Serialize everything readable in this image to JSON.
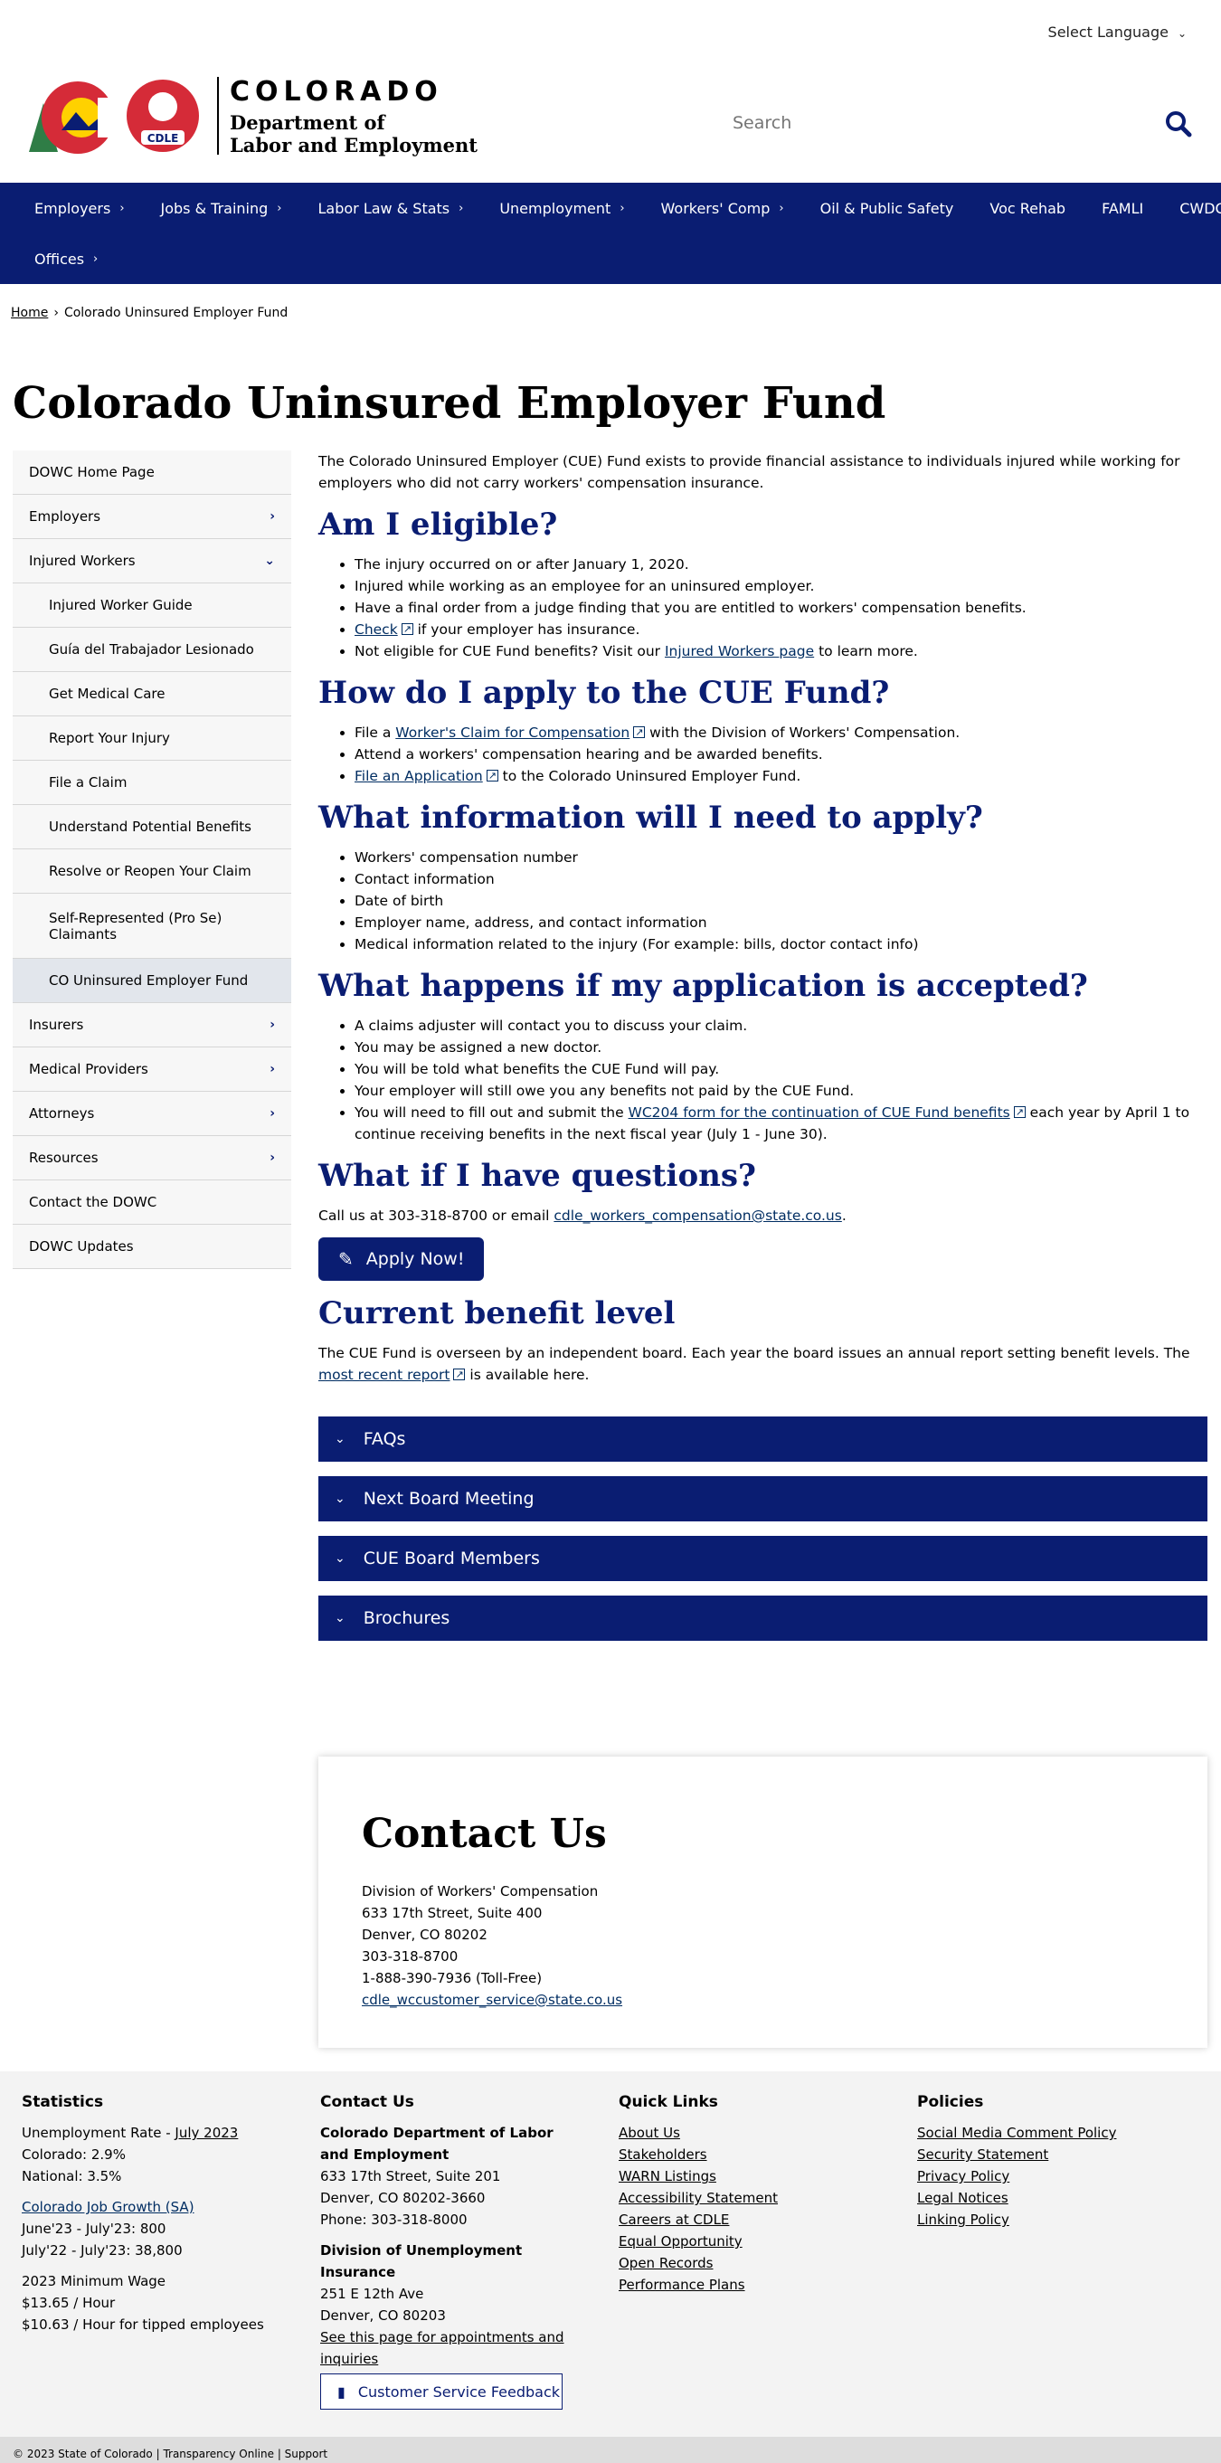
{
  "topbar": {
    "language": "Select Language"
  },
  "logo": {
    "state": "COLORADO",
    "dept_line1": "Department of",
    "dept_line2": "Labor and Employment",
    "badge": "CDLE"
  },
  "search": {
    "placeholder": "Search"
  },
  "nav": {
    "row1": [
      {
        "label": "Employers",
        "caret": true
      },
      {
        "label": "Jobs & Training",
        "caret": true
      },
      {
        "label": "Labor Law & Stats",
        "caret": true
      },
      {
        "label": "Unemployment",
        "caret": true
      },
      {
        "label": "Workers' Comp",
        "caret": true
      },
      {
        "label": "Oil & Public Safety",
        "caret": false
      },
      {
        "label": "Voc Rehab",
        "caret": false
      },
      {
        "label": "FAMLI",
        "caret": false
      },
      {
        "label": "CWDC",
        "caret": false
      }
    ],
    "row2": [
      {
        "label": "Offices",
        "caret": true
      }
    ]
  },
  "breadcrumb": {
    "home": "Home",
    "sep": "›",
    "current": "Colorado Uninsured Employer Fund"
  },
  "page_title": "Colorado Uninsured Employer Fund",
  "sidebar": [
    {
      "label": "DOWC Home Page",
      "level": 0,
      "caret": ""
    },
    {
      "label": "Employers",
      "level": 0,
      "caret": "›"
    },
    {
      "label": "Injured Workers",
      "level": 0,
      "caret": "⌄"
    },
    {
      "label": "Injured Worker Guide",
      "level": 1,
      "caret": ""
    },
    {
      "label": "Guía del Trabajador Lesionado",
      "level": 1,
      "caret": ""
    },
    {
      "label": "Get Medical Care",
      "level": 1,
      "caret": ""
    },
    {
      "label": "Report Your Injury",
      "level": 1,
      "caret": ""
    },
    {
      "label": "File a Claim",
      "level": 1,
      "caret": ""
    },
    {
      "label": "Understand Potential Benefits",
      "level": 1,
      "caret": ""
    },
    {
      "label": "Resolve or Reopen Your Claim",
      "level": 1,
      "caret": ""
    },
    {
      "label": "Self-Represented (Pro Se) Claimants",
      "level": 1,
      "caret": "",
      "tall": true
    },
    {
      "label": "CO Uninsured Employer Fund",
      "level": 1,
      "caret": "",
      "active": true
    },
    {
      "label": "Insurers",
      "level": 0,
      "caret": "›"
    },
    {
      "label": "Medical Providers",
      "level": 0,
      "caret": "›"
    },
    {
      "label": "Attorneys",
      "level": 0,
      "caret": "›"
    },
    {
      "label": "Resources",
      "level": 0,
      "caret": "›"
    },
    {
      "label": "Contact the DOWC",
      "level": 0,
      "caret": ""
    },
    {
      "label": "DOWC Updates",
      "level": 0,
      "caret": ""
    }
  ],
  "content": {
    "intro": "The Colorado Uninsured Employer (CUE) Fund exists to provide financial assistance to individuals injured while working for employers who did not carry workers' compensation insurance.",
    "eligible": {
      "heading": "Am I eligible?",
      "items": [
        "The injury occurred on or after January 1, 2020.",
        "Injured while working as an employee for an uninsured employer.",
        "Have a final order from a judge finding that you are entitled to workers' compensation benefits."
      ],
      "check_link": "Check",
      "check_rest": " if your employer has insurance.",
      "not_eligible_pre": "Not eligible for CUE Fund benefits? Visit our ",
      "not_eligible_link": "Injured Workers page",
      "not_eligible_post": " to learn more."
    },
    "apply": {
      "heading": "How do I apply to the CUE Fund?",
      "item1_pre": "File a ",
      "item1_link": "Worker's Claim for Compensation",
      "item1_post": " with the Division of Workers' Compensation.",
      "item2": "Attend a workers' compensation hearing and be awarded benefits.",
      "item3_link": "File an Application",
      "item3_post": " to the Colorado Uninsured Employer Fund."
    },
    "info": {
      "heading": "What information will I need to apply?",
      "items": [
        "Workers' compensation number",
        "Contact information",
        "Date of birth",
        "Employer name, address, and contact information",
        "Medical information related to the injury (For example: bills, doctor contact info)"
      ]
    },
    "accepted": {
      "heading": "What happens if my application is accepted?",
      "items": [
        "A claims adjuster will contact you to discuss your claim.",
        "You may be assigned a new doctor.",
        "You will be told what benefits the CUE Fund will pay.",
        "Your employer will still owe you any benefits not paid by the CUE Fund."
      ],
      "last_pre": "You will need to fill out and submit the ",
      "last_link": "WC204 form for the continuation of CUE Fund benefits",
      "last_post": " each year by April 1 to continue receiving benefits in the next fiscal year (July 1 - June 30)."
    },
    "questions": {
      "heading": "What if I have questions?",
      "text_pre": "Call us at 303-318-8700 or email ",
      "email": "cdle_workers_compensation@state.co.us",
      "text_post": "."
    },
    "apply_button": "Apply Now!",
    "benefit": {
      "heading": "Current benefit level",
      "text_pre": "The CUE Fund is overseen by an independent board. Each year the board issues an annual report setting benefit levels. The ",
      "link": "most recent report",
      "text_post": " is available here."
    },
    "accordions": [
      "FAQs",
      "Next Board Meeting",
      "CUE Board Members",
      "Brochures"
    ]
  },
  "contact_card": {
    "heading": "Contact Us",
    "lines": [
      "Division of Workers' Compensation",
      "633 17th Street, Suite 400",
      "Denver, CO 80202",
      "303-318-8700",
      "1-888-390-7936 (Toll-Free)"
    ],
    "email": "cdle_wccustomer_service@state.co.us"
  },
  "footer": {
    "statistics": {
      "heading": "Statistics",
      "unemp_pre": "Unemployment Rate - ",
      "unemp_link": "July 2023",
      "colorado": "Colorado: 2.9%",
      "national": "National: 3.5%",
      "jobgrowth_link": "Colorado Job Growth (SA)",
      "jg1": "June'23 - July'23: 800",
      "jg2": "July'22 - July'23: 38,800",
      "minwage_title": "2023 Minimum Wage",
      "mw1": "$13.65 / Hour",
      "mw2": "$10.63 / Hour for tipped employees"
    },
    "contact": {
      "heading": "Contact Us",
      "org1": "Colorado Department of Labor and Employment",
      "addr1": "633 17th Street, Suite 201",
      "city1": "Denver, CO  80202-3660",
      "phone1": "Phone: 303-318-8000",
      "org2": "Division of Unemployment Insurance",
      "addr2": "251 E 12th Ave",
      "city2": "Denver, CO  80203",
      "appt_link": "See this page for appointments and inquiries"
    },
    "quick_links": {
      "heading": "Quick Links",
      "links": [
        "About Us",
        "Stakeholders",
        "WARN Listings",
        "Accessibility Statement",
        "Careers at CDLE",
        "Equal Opportunity",
        "Open Records",
        "Performance Plans"
      ]
    },
    "policies": {
      "heading": "Policies",
      "links": [
        "Social Media Comment Policy",
        "Security Statement",
        "Privacy Policy",
        "Legal Notices",
        "Linking Policy"
      ]
    },
    "feedback_button": "Customer Service Feedback",
    "bottom": "© 2023 State of Colorado  |  Transparency Online  |  Support"
  },
  "colors": {
    "navy": "#0a1d72",
    "link": "#002d62",
    "footer_bg": "#f3f3f3"
  }
}
